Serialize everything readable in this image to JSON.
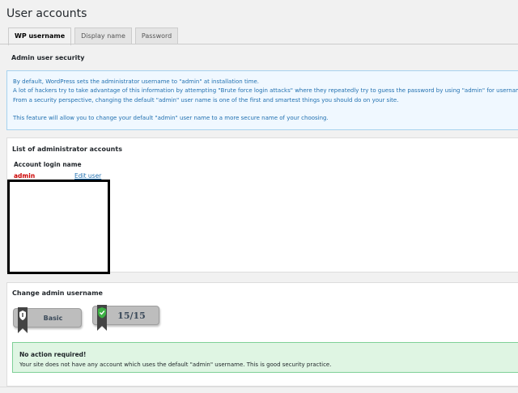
{
  "page": {
    "title": "User accounts"
  },
  "tabs": [
    {
      "label": "WP username",
      "active": true
    },
    {
      "label": "Display name",
      "active": false
    },
    {
      "label": "Password",
      "active": false
    }
  ],
  "security_section": {
    "heading": "Admin user security",
    "info_lines": [
      "By default, WordPress sets the administrator username to \"admin\" at installation time.",
      "A lot of hackers try to take advantage of this information by attempting \"Brute force login attacks\" where they repeatedly try to guess the password by using \"admin\" for username.",
      "From a security perspective, changing the default \"admin\" user name is one of the first and smartest things you should do on your site."
    ],
    "info_line_4": "This feature will allow you to change your default \"admin\" user name to a more secure name of your choosing."
  },
  "admin_list": {
    "title": "List of administrator accounts",
    "column_header": "Account login name",
    "accounts": [
      {
        "login": "admin",
        "action": "Edit user"
      }
    ]
  },
  "change_section": {
    "title": "Change admin username",
    "badge_level": "Basic",
    "badge_score": "15/15",
    "success_title": "No action required!",
    "success_text": "Your site does not have any account which uses the default \"admin\" username. This is good security practice."
  },
  "colors": {
    "link": "#2271b1",
    "admin_name": "#cc0000",
    "info_bg": "#f0f8ff",
    "success_bg": "#dff5e3"
  },
  "icons": {
    "badge_basic": "shield-icon",
    "badge_score": "shield-check-icon"
  }
}
